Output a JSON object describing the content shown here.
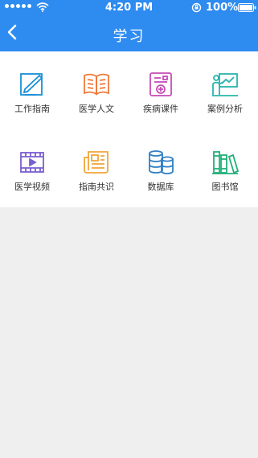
{
  "status_bar": {
    "time": "4:20 PM",
    "battery": "100%"
  },
  "nav": {
    "title": "学习",
    "back_icon": "chevron-left-icon"
  },
  "grid": {
    "items": [
      {
        "label": "工作指南",
        "icon": "guide-edit-icon",
        "color": "#1a8fd6"
      },
      {
        "label": "医学人文",
        "icon": "open-book-icon",
        "color": "#ee7a3a"
      },
      {
        "label": "疾病课件",
        "icon": "courseware-icon",
        "color": "#c74bb8"
      },
      {
        "label": "案例分析",
        "icon": "presentation-icon",
        "color": "#27b4ad"
      },
      {
        "label": "医学视频",
        "icon": "video-film-icon",
        "color": "#7a5fd0"
      },
      {
        "label": "指南共识",
        "icon": "newspaper-icon",
        "color": "#f0a53a"
      },
      {
        "label": "数据库",
        "icon": "database-icon",
        "color": "#2f7fc4"
      },
      {
        "label": "图书馆",
        "icon": "library-books-icon",
        "color": "#22b07a"
      }
    ]
  }
}
